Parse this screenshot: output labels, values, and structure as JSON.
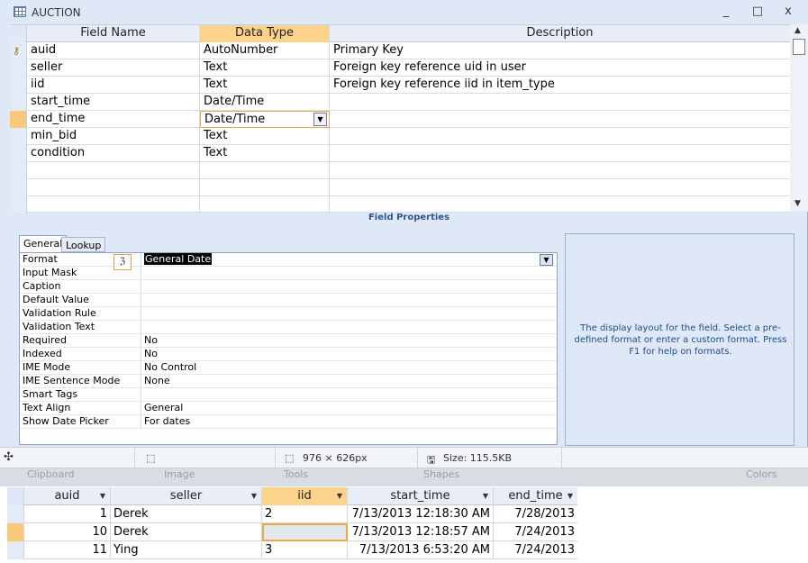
{
  "window": {
    "title": "AUCTION",
    "controls": [
      "_",
      "□",
      "x"
    ]
  },
  "design_grid": {
    "headers": {
      "field_name": "Field Name",
      "data_type": "Data Type",
      "description": "Description"
    },
    "rows": [
      {
        "field_name": "auid",
        "data_type": "AutoNumber",
        "description": "Primary Key",
        "primary_key": true
      },
      {
        "field_name": "seller",
        "data_type": "Text",
        "description": "Foreign key reference uid in user"
      },
      {
        "field_name": "iid",
        "data_type": "Text",
        "description": "Foreign key reference iid in item_type"
      },
      {
        "field_name": "start_time",
        "data_type": "Date/Time",
        "description": ""
      },
      {
        "field_name": "end_time",
        "data_type": "Date/Time",
        "description": "",
        "selected": true
      },
      {
        "field_name": "min_bid",
        "data_type": "Text",
        "description": ""
      },
      {
        "field_name": "condition",
        "data_type": "Text",
        "description": ""
      },
      {
        "field_name": "",
        "data_type": "",
        "description": ""
      },
      {
        "field_name": "",
        "data_type": "",
        "description": ""
      },
      {
        "field_name": "",
        "data_type": "",
        "description": ""
      }
    ]
  },
  "field_properties": {
    "title": "Field Properties",
    "tabs": {
      "general": "General",
      "lookup": "Lookup"
    },
    "rows": [
      {
        "label": "Format",
        "value": "General Date",
        "selected": true
      },
      {
        "label": "Input Mask",
        "value": ""
      },
      {
        "label": "Caption",
        "value": ""
      },
      {
        "label": "Default Value",
        "value": ""
      },
      {
        "label": "Validation Rule",
        "value": ""
      },
      {
        "label": "Validation Text",
        "value": ""
      },
      {
        "label": "Required",
        "value": "No"
      },
      {
        "label": "Indexed",
        "value": "No"
      },
      {
        "label": "IME Mode",
        "value": "No Control"
      },
      {
        "label": "IME Sentence Mode",
        "value": "None"
      },
      {
        "label": "Smart Tags",
        "value": ""
      },
      {
        "label": "Text Align",
        "value": "General"
      },
      {
        "label": "Show Date Picker",
        "value": "For dates"
      }
    ],
    "help_text": "The display layout for the field.  Select a pre-defined format or enter a custom format.  Press F1 for help on formats."
  },
  "status_bar": {
    "dimensions": "976 × 626px",
    "size": "Size: 115.5KB"
  },
  "ribbon_labels": [
    "Clipboard",
    "Image",
    "Tools",
    "Shapes",
    "Colors"
  ],
  "datasheet": {
    "headers": {
      "auid": "auid",
      "seller": "seller",
      "iid": "iid",
      "start_time": "start_time",
      "end_time": "end_time"
    },
    "rows": [
      {
        "auid": "1",
        "seller": "Derek",
        "iid": "2",
        "start_time": "7/13/2013 12:18:30 AM",
        "end_time": "7/28/2013"
      },
      {
        "auid": "10",
        "seller": "Derek",
        "iid": "",
        "start_time": "7/13/2013 12:18:57 AM",
        "end_time": "7/24/2013",
        "selected": true
      },
      {
        "auid": "11",
        "seller": "Ying",
        "iid": "3",
        "start_time": "7/13/2013 6:53:20 AM",
        "end_time": "7/24/2013"
      }
    ]
  },
  "colors": {
    "accent_header": "#fbd38a",
    "selector_active": "#f8c97a",
    "window_bg": "#dfe8f6"
  }
}
